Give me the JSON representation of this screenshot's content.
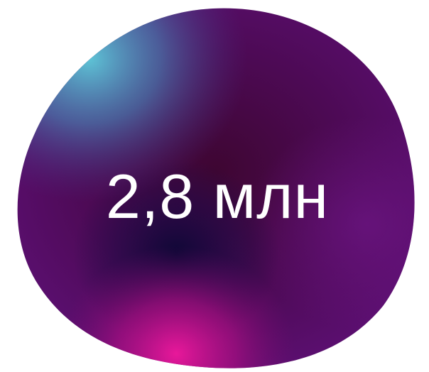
{
  "stat": {
    "value": "2,8 млн"
  },
  "colors": {
    "background": "#ffffff",
    "blob_base": "#5a0f6e",
    "blob_center_dark": "#3a0430",
    "blob_highlight_cyan": "#4fb3c9",
    "blob_highlight_magenta": "#e0158f",
    "blob_shadow_navy": "#16083d",
    "text": "#ffffff"
  }
}
